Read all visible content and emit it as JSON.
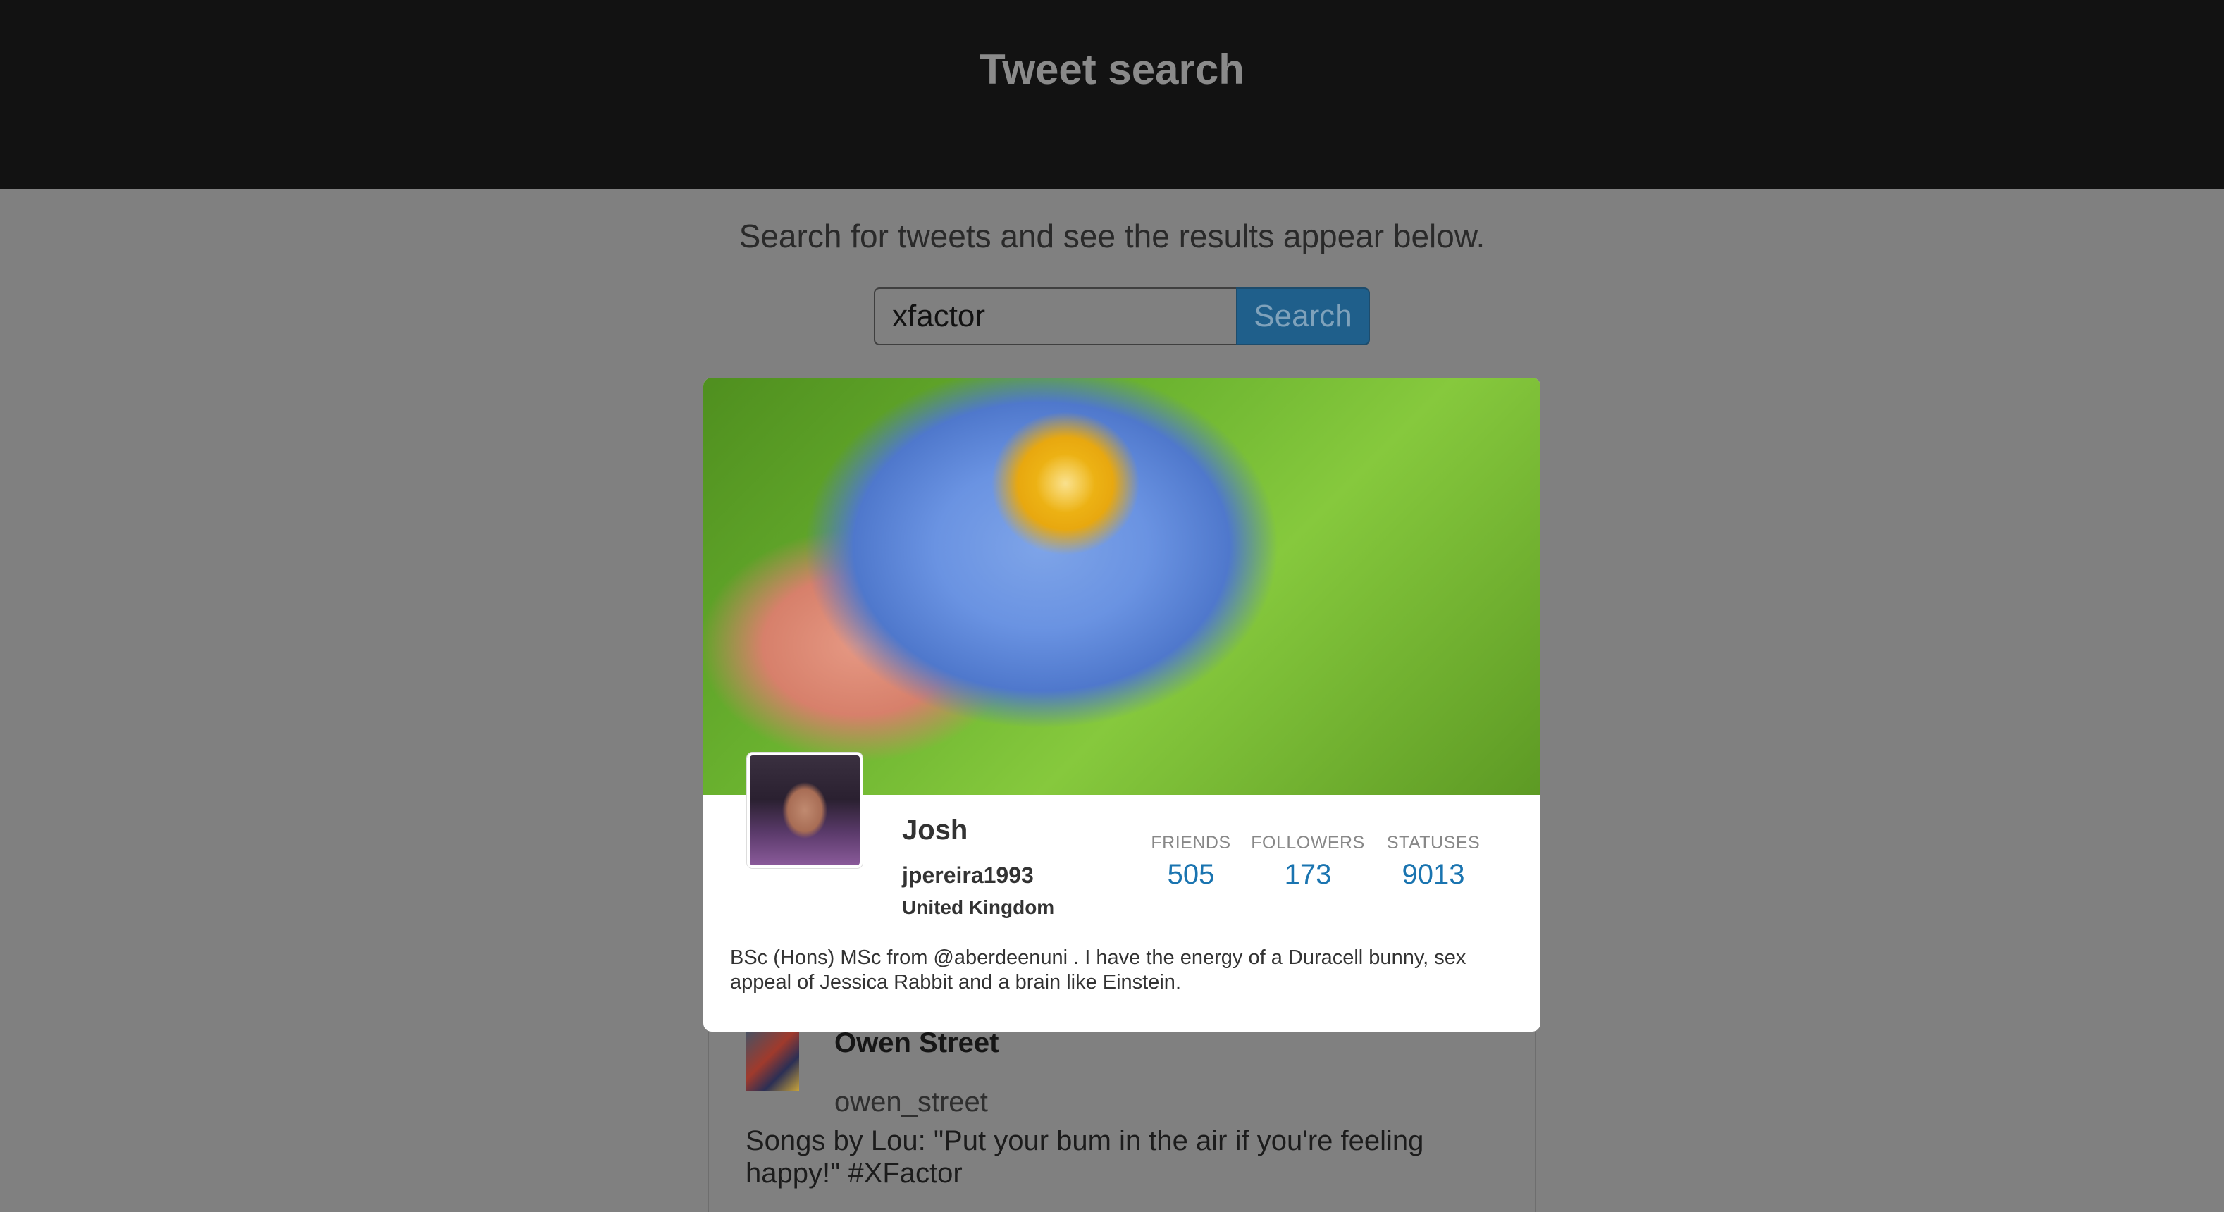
{
  "header": {
    "title": "Tweet search"
  },
  "subtitle": "Search for tweets and see the results appear below.",
  "search": {
    "value": "xfactor",
    "button_label": "Search"
  },
  "tweet": {
    "name": "Owen Street",
    "handle": "owen_street",
    "text": "Songs by Lou: \"Put your bum in the air if you're feeling happy!\" #XFactor"
  },
  "profile": {
    "name": "Josh",
    "handle": "jpereira1993",
    "location": "United Kingdom",
    "stats": {
      "friends_label": "FRIENDS",
      "friends": "505",
      "followers_label": "FOLLOWERS",
      "followers": "173",
      "statuses_label": "STATUSES",
      "statuses": "9013"
    },
    "bio": "BSc (Hons) MSc from @aberdeenuni . I have the energy of a Duracell bunny, sex appeal of Jessica Rabbit and a brain like Einstein."
  },
  "colors": {
    "header_bg": "#121212",
    "page_overlay": "#808080",
    "button_blue": "#1f5f8b",
    "stat_value": "#1a74b0"
  }
}
